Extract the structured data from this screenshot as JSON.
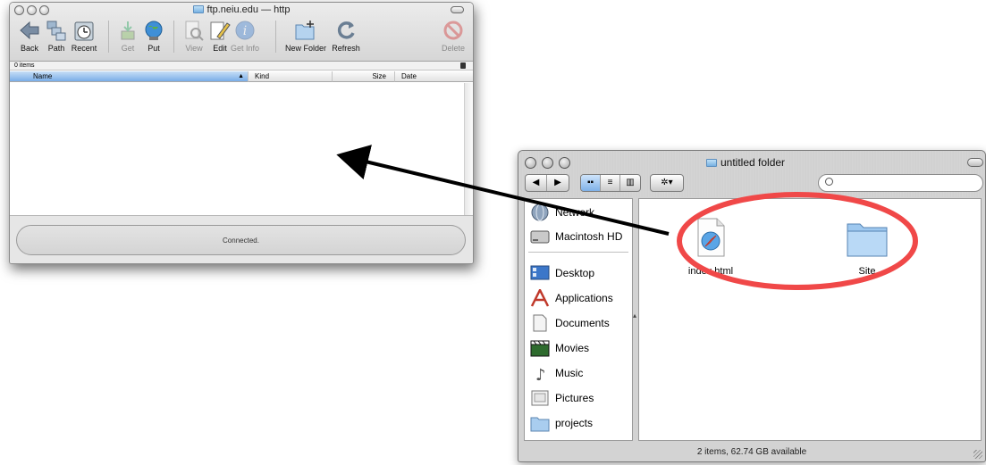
{
  "ftp_window": {
    "title": "ftp.neiu.edu — http",
    "toolbar": [
      {
        "label": "Back",
        "icon": "back-arrow-icon",
        "enabled": true
      },
      {
        "label": "Path",
        "icon": "path-icon",
        "enabled": true
      },
      {
        "label": "Recent",
        "icon": "recent-clock-icon",
        "enabled": true
      },
      {
        "label": "Get",
        "icon": "get-download-icon",
        "enabled": false
      },
      {
        "label": "Put",
        "icon": "put-globe-icon",
        "enabled": true
      },
      {
        "label": "View",
        "icon": "view-magnifier-icon",
        "enabled": false
      },
      {
        "label": "Edit",
        "icon": "edit-pencil-icon",
        "enabled": true
      },
      {
        "label": "Get Info",
        "icon": "info-icon",
        "enabled": false
      },
      {
        "label": "New Folder",
        "icon": "new-folder-icon",
        "enabled": true
      },
      {
        "label": "Refresh",
        "icon": "refresh-icon",
        "enabled": true
      },
      {
        "label": "Delete",
        "icon": "delete-icon",
        "enabled": false
      }
    ],
    "items_count": "0 items",
    "columns": [
      "Name",
      "Kind",
      "Size",
      "Date"
    ],
    "sorted_column": "Name",
    "status": "Connected."
  },
  "finder_window": {
    "title": "untitled folder",
    "sidebar": [
      {
        "label": "Network",
        "icon": "network-globe-icon"
      },
      {
        "label": "Macintosh HD",
        "icon": "hard-drive-icon"
      },
      {
        "label": "Desktop",
        "icon": "desktop-icon"
      },
      {
        "label": "Applications",
        "icon": "applications-icon"
      },
      {
        "label": "Documents",
        "icon": "documents-icon"
      },
      {
        "label": "Movies",
        "icon": "movies-clapper-icon"
      },
      {
        "label": "Music",
        "icon": "music-note-icon"
      },
      {
        "label": "Pictures",
        "icon": "pictures-icon"
      },
      {
        "label": "projects",
        "icon": "folder-icon"
      }
    ],
    "files": [
      {
        "label": "index.html",
        "icon": "safari-html-icon"
      },
      {
        "label": "Site",
        "icon": "folder-icon"
      }
    ],
    "status": "2 items, 62.74 GB available"
  },
  "annotation": {
    "arrow_color": "#000000",
    "highlight_color": "#f04848"
  }
}
